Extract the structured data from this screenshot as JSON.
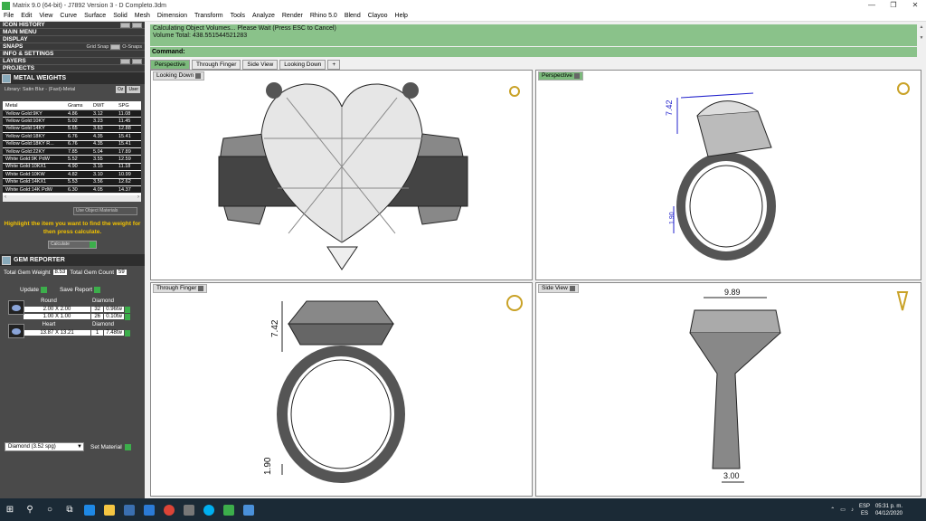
{
  "window": {
    "title": "Matrix 9.0 (64-bit) - J7892 Version 3 - D Completo.3dm",
    "controls": [
      "—",
      "❐",
      "✕"
    ]
  },
  "menu": [
    "File",
    "Edit",
    "View",
    "Curve",
    "Surface",
    "Solid",
    "Mesh",
    "Dimension",
    "Transform",
    "Tools",
    "Analyze",
    "Render",
    "Rhino 5.0",
    "Blend",
    "Clayoo",
    "Help"
  ],
  "sidebar": {
    "sections": [
      "ICON HISTORY",
      "MAIN MENU",
      "DISPLAY",
      "SNAPS",
      "INFO & SETTINGS",
      "LAYERS",
      "PROJECTS"
    ],
    "snaps_grid": "Grid Snap",
    "snaps_osnap": "O-Snaps",
    "metal": {
      "title": "METAL WEIGHTS",
      "library": "Library: Satin Blur - (Fast)-Metal",
      "lib_btn1": "Oz",
      "lib_btn2": "User",
      "columns": [
        "Metal",
        "Grams",
        "DWT",
        "SPG"
      ],
      "rows": [
        [
          "Yellow Gold:9KY",
          "4.86",
          "3.12",
          "11.08"
        ],
        [
          "Yellow Gold:10KY",
          "5.02",
          "3.23",
          "11.45"
        ],
        [
          "Yellow Gold:14KY",
          "5.65",
          "3.63",
          "12.88"
        ],
        [
          "Yellow Gold:18KY",
          "6.76",
          "4.35",
          "15.41"
        ],
        [
          "Yellow Gold:18KY R...",
          "6.76",
          "4.35",
          "15.41"
        ],
        [
          "Yellow Gold:22KY",
          "7.85",
          "5.04",
          "17.89"
        ],
        [
          "White Gold:9K PdW",
          "5.52",
          "3.55",
          "12.59"
        ],
        [
          "White Gold:10KX1",
          "4.90",
          "3.15",
          "11.18"
        ],
        [
          "White Gold:10KW",
          "4.82",
          "3.10",
          "10.99"
        ],
        [
          "White Gold:14KX1",
          "5.53",
          "3.56",
          "12.62"
        ],
        [
          "White Gold:14K PdW",
          "6.30",
          "4.05",
          "14.37"
        ]
      ],
      "use_object_materials": "Use Object Materials",
      "hint": "Highlight the item you want to find the weight for then press calculate.",
      "calculate": "Calculate"
    },
    "gem": {
      "title": "GEM REPORTER",
      "total_weight_label": "Total Gem Weight",
      "total_weight": "8.53",
      "total_count_label": "Total Gem Count",
      "total_count": "59",
      "update": "Update",
      "save_report": "Save Report",
      "groups": [
        {
          "shape": "Round",
          "type": "Diamond",
          "rows": [
            [
              "2.00 X 2.00",
              "32",
              "0.96tw"
            ],
            [
              "1.00 X 1.00",
              "26",
              "0.10tw"
            ]
          ]
        },
        {
          "shape": "Heart",
          "type": "Diamond",
          "rows": [
            [
              "13.87 X 13.21",
              "1",
              "7.48tw"
            ]
          ]
        }
      ]
    },
    "material_select": "Diamond    (3.52 spg)",
    "set_material": "Set Material"
  },
  "command": {
    "line1": "Calculating Object Volumes... Please Wait (Press ESC to Cancel)",
    "line2": "Volume Total: 438.551544521283",
    "label": "Command:"
  },
  "tabs": [
    "Perspective",
    "Through Finger",
    "Side View",
    "Looking Down",
    "+"
  ],
  "viewports": {
    "tl": "Looking Down",
    "tr": "Perspective",
    "bl": "Through Finger",
    "br": "Side View"
  },
  "dimensions": {
    "persp_a": "7.42",
    "persp_b": "1.90",
    "tf_height": "7.42",
    "tf_bottom": "1.90",
    "sv_width": "9.89",
    "sv_bottom": "3.00"
  },
  "taskbar": {
    "lang1": "ESP",
    "lang2": "ES",
    "time": "05:31 p. m.",
    "date": "04/12/2020"
  }
}
